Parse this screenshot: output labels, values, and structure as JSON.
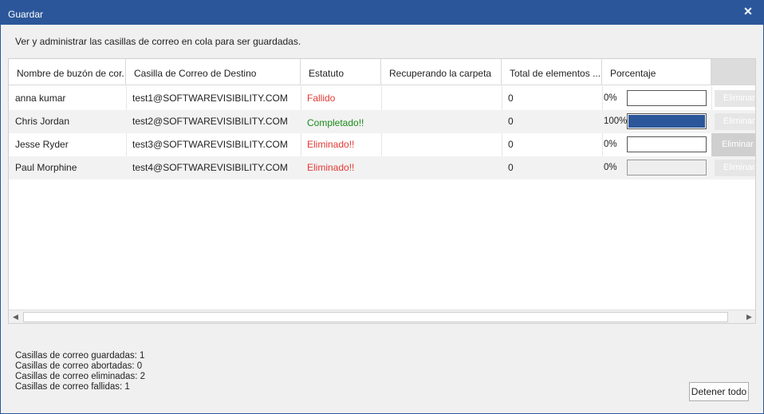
{
  "window": {
    "title": "Guardar",
    "close_glyph": "✕"
  },
  "description": "Ver y administrar las casillas de correo en cola para ser guardadas.",
  "grid": {
    "columns": [
      "Nombre de buzón de cor...",
      "Casilla de Correo de Destino",
      "Estatuto",
      "Recuperando la carpeta",
      "Total de elementos ...",
      "Porcentaje",
      ""
    ],
    "rows": [
      {
        "name": "anna kumar",
        "destination": "test1@SOFTWAREVISIBILITY.COM",
        "status": "Fallido",
        "status_kind": "error",
        "folder": "",
        "total": "0",
        "percent_label": "0%",
        "progress": 0,
        "delete_label": "Eliminar"
      },
      {
        "name": "Chris Jordan",
        "destination": "test2@SOFTWAREVISIBILITY.COM",
        "status": "Completado!!",
        "status_kind": "success",
        "folder": "",
        "total": "0",
        "percent_label": "100%",
        "progress": 1,
        "delete_label": "Eliminar"
      },
      {
        "name": "Jesse Ryder",
        "destination": "test3@SOFTWAREVISIBILITY.COM",
        "status": "Eliminado!!",
        "status_kind": "error",
        "folder": "",
        "total": "0",
        "percent_label": "0%",
        "progress": 0,
        "delete_label": "Eliminar"
      },
      {
        "name": "Paul Morphine",
        "destination": "test4@SOFTWAREVISIBILITY.COM",
        "status": "Eliminado!!",
        "status_kind": "error",
        "folder": "",
        "total": "0",
        "percent_label": "0%",
        "progress": 0,
        "delete_label": "Eliminar"
      }
    ]
  },
  "summary": {
    "saved": "Casillas de correo guardadas: 1",
    "aborted": "Casillas de correo abortadas: 0",
    "deleted": "Casillas de correo eliminadas: 2",
    "failed": "Casillas de correo fallidas: 1"
  },
  "buttons": {
    "stop_all": "Detener todo"
  },
  "colors": {
    "accent": "#2b579a",
    "error": "#e53935",
    "success": "#1a8a1a"
  }
}
